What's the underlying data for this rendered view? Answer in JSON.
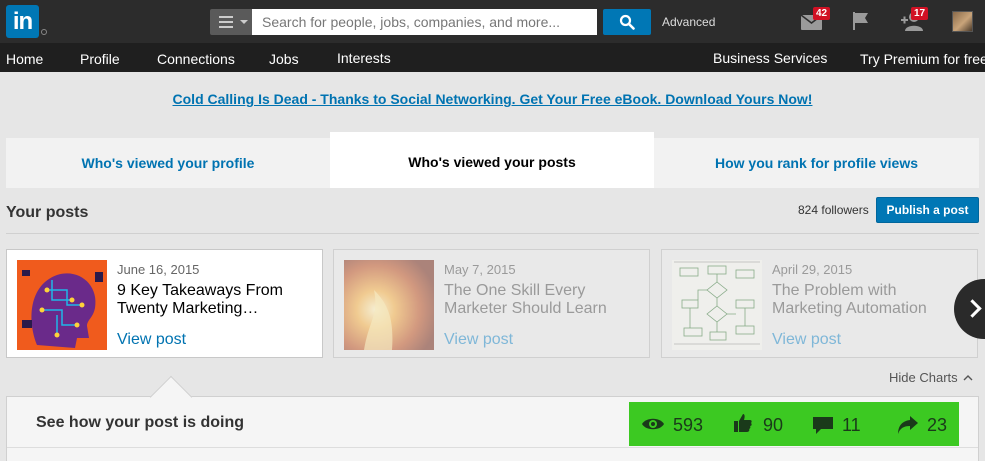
{
  "header": {
    "logo_text": "in",
    "search_placeholder": "Search for people, jobs, companies, and more...",
    "advanced_label": "Advanced",
    "messages_count": "42",
    "connections_count": "17"
  },
  "nav": {
    "items": [
      "Home",
      "Profile",
      "Connections",
      "Jobs",
      "Interests"
    ],
    "right_items": [
      "Business Services",
      "Try Premium for free"
    ]
  },
  "promo": {
    "text": "Cold Calling Is Dead - Thanks to Social Networking. Get Your Free eBook. Download Yours Now!"
  },
  "tabs": [
    {
      "label": "Who's viewed your profile",
      "active": false
    },
    {
      "label": "Who's viewed your posts",
      "active": true
    },
    {
      "label": "How you rank for profile views",
      "active": false
    }
  ],
  "posts_section": {
    "title": "Your posts",
    "followers": "824 followers",
    "publish_label": "Publish a post"
  },
  "posts": [
    {
      "date": "June 16, 2015",
      "title": "9 Key Takeaways From Twenty Marketing…",
      "link": "View post",
      "thumb_icon": "circuit-head-image"
    },
    {
      "date": "May 7, 2015",
      "title": "The One Skill Every Marketer Should Learn",
      "link": "View post",
      "thumb_icon": "fire-image"
    },
    {
      "date": "April 29, 2015",
      "title": "The Problem with Marketing Automation",
      "link": "View post",
      "thumb_icon": "flowchart-image"
    }
  ],
  "charts": {
    "hide_label": "Hide Charts",
    "panel_title": "See how your post is doing",
    "views": "593",
    "likes": "90",
    "comments": "11",
    "shares": "23"
  },
  "colors": {
    "brand": "#0077b5",
    "stats_bg": "#3cc922",
    "badge": "#d11124"
  }
}
